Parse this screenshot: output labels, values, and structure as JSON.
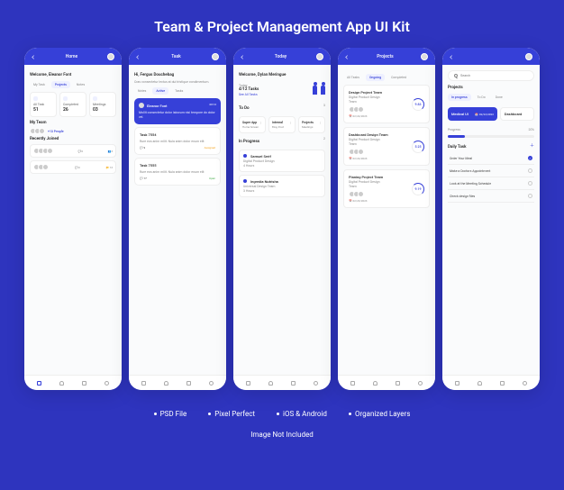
{
  "title": "Team & Project Management App UI Kit",
  "features": [
    "PSD File",
    "Pixel Perfect",
    "iOS & Android",
    "Organized Layers"
  ],
  "footer": "Image Not Included",
  "screen1": {
    "header": "Home",
    "welcome": "Welcome, Eleanor Font",
    "tabs": [
      "My Task",
      "Projects",
      "Notes"
    ],
    "stats": {
      "all_label": "All Task",
      "all_value": "51",
      "completed_label": "Completed",
      "completed_value": "26",
      "meetings_label": "Meetings",
      "meetings_value": "03"
    },
    "my_team_title": "My Team",
    "plus_people": "+13 People",
    "recently_joined_title": "Recently Joined",
    "comments_count": "0",
    "members_count": "3",
    "open_count": "13"
  },
  "screen2": {
    "header": "Task",
    "greeting": "Hi, Fergus Douchebag",
    "subtitle": "Cras consectetur lectus at dui tristique condimentum.",
    "tabs": [
      "Notes",
      "Active",
      "Tasks"
    ],
    "card_name": "Eleanor Font",
    "card_time": "08:13",
    "card_text": "Mollit consectetur dolor laborum nisi tempore do dolor vel.",
    "task1_title": "Task 7554",
    "task1_meta": "Rure eos anim milit. Nula anim dolor enum elit",
    "task1_status": "Assigned",
    "task1_count": "9",
    "task2_title": "Task 7555",
    "task2_meta": "Rure eos anim milit. Nula anim dolor enum elit",
    "task2_status": "Open",
    "task2_count": "17"
  },
  "screen3": {
    "header": "Today",
    "welcome": "Welcome, Dylan Meringue",
    "today_label": "Today",
    "today_count": "4/12 Tasks",
    "see_all": "See All Tasks",
    "todo_title": "To Do",
    "todo_count": "3",
    "grid": [
      {
        "t": "Super App",
        "s": "Home Screen"
      },
      {
        "t": "Internal",
        "s": "Blog Post"
      },
      {
        "t": "Projects",
        "s": "Meetings"
      }
    ],
    "inprogress_title": "In Progress",
    "inprogress_count": "2",
    "p1_name": "Samuel Serif",
    "p1_role": "Digital Product Design",
    "p1_time": "4 Hours",
    "p2_name": "Ingredia Nutrisha",
    "p2_role": "Universal Design Team",
    "p2_time": "3 Hours"
  },
  "screen4": {
    "header": "Projects",
    "tabs": [
      "All Tasks",
      "Ongoing",
      "Completed"
    ],
    "p1_title": "Design Project Team",
    "p1_sub": "Digital Product Design",
    "p1_team": "Team",
    "p1_date": "02/24/2023",
    "p1_pct": "9.83",
    "p2_title": "Dashboard Design Team",
    "p2_sub": "Digital Product Design",
    "p2_team": "Team",
    "p2_date": "02/24/2023",
    "p2_pct": "5.25",
    "p3_title": "Planing Project Team",
    "p3_sub": "Digital Product Design",
    "p3_team": "Team",
    "p3_date": "02/23/2023",
    "p3_pct": "9.19"
  },
  "screen5": {
    "search_placeholder": "Search",
    "projects_title": "Projects",
    "tabs": [
      "In progress",
      "To Do",
      "Done"
    ],
    "proj1": "Medical UI",
    "proj1_date": "02/22/2023",
    "proj2": "Dashboard",
    "progress_label": "Progress",
    "progress_pct": "20%",
    "daily_title": "Daily Task",
    "d1": "Order Your Meal",
    "d2": "Make a Doctors Appointment",
    "d3": "Look at the Meeting Schedule",
    "d4": "Check design files"
  }
}
